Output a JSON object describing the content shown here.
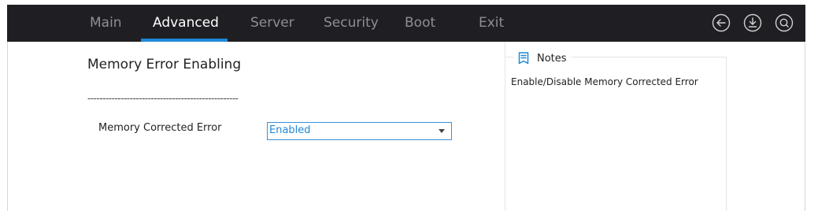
{
  "tabs": [
    {
      "label": "Main",
      "active": false
    },
    {
      "label": "Advanced",
      "active": true
    },
    {
      "label": "Server",
      "active": false
    },
    {
      "label": "Security",
      "active": false
    },
    {
      "label": "Boot",
      "active": false
    },
    {
      "label": "Exit",
      "active": false
    }
  ],
  "top_icons": [
    "back-arrow-icon",
    "download-icon",
    "search-icon"
  ],
  "page": {
    "title": "Memory Error Enabling",
    "divider": "--------------------------------------------------"
  },
  "settings": [
    {
      "label": "Memory Corrected Error",
      "value": "Enabled"
    }
  ],
  "notes": {
    "icon": "notes-icon",
    "title": "Notes",
    "text": "Enable/Disable Memory Corrected Error"
  },
  "colors": {
    "topbar_bg": "#1f1f23",
    "accent": "#1e88d8",
    "tab_inactive": "#8e8e93",
    "tab_active": "#ffffff"
  }
}
